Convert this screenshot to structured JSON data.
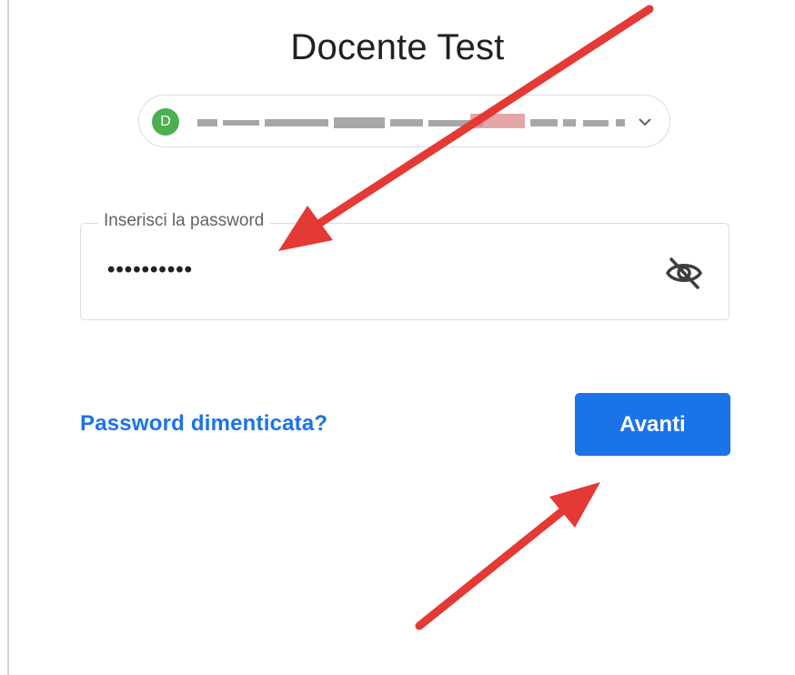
{
  "header": {
    "title": "Docente Test"
  },
  "account": {
    "avatar_letter": "D",
    "avatar_color": "#4caf50"
  },
  "password_field": {
    "label": "Inserisci la password",
    "value": "••••••••••"
  },
  "actions": {
    "forgot_link": "Password dimenticata?",
    "next_button": "Avanti"
  },
  "colors": {
    "accent": "#1a73e8",
    "annotation_arrow": "#e53935"
  },
  "icons": {
    "visibility_toggle": "eye-off-icon",
    "account_dropdown": "chevron-down-icon"
  }
}
